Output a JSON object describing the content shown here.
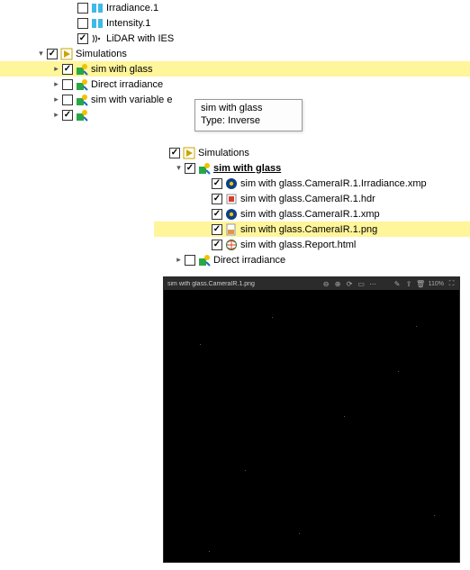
{
  "outer": {
    "items": [
      {
        "indent": 74,
        "exp": "",
        "chk": false,
        "icon": "sensor-icon",
        "label": "Irradiance.1"
      },
      {
        "indent": 74,
        "exp": "",
        "chk": false,
        "icon": "sensor-icon",
        "label": "Intensity.1"
      },
      {
        "indent": 74,
        "exp": "",
        "chk": true,
        "icon": "antenna-icon",
        "label": "LiDAR with IES"
      },
      {
        "indent": 40,
        "exp": "▾",
        "chk": true,
        "icon": "play-icon",
        "label": "Simulations"
      },
      {
        "indent": 57,
        "exp": "▸",
        "chk": true,
        "icon": "sim-icon",
        "label": "sim with glass",
        "sel": true
      },
      {
        "indent": 57,
        "exp": "▸",
        "chk": false,
        "icon": "sim-icon",
        "label": "Direct irradiance"
      },
      {
        "indent": 57,
        "exp": "▸",
        "chk": false,
        "icon": "sim-icon",
        "label": "sim with variable e"
      },
      {
        "indent": 57,
        "exp": "▸",
        "chk": true,
        "icon": "sim-icon",
        "label": ""
      }
    ]
  },
  "tooltip": {
    "line1": "sim with glass",
    "line2": "Type: Inverse"
  },
  "inner": {
    "items": [
      {
        "indent": 5,
        "exp": "",
        "chk": true,
        "icon": "play-icon",
        "label": "Simulations"
      },
      {
        "indent": 22,
        "exp": "▾",
        "chk": true,
        "icon": "sim-icon",
        "label": "sim with glass",
        "bold": true,
        "ul": true
      },
      {
        "indent": 52,
        "exp": "",
        "chk": true,
        "icon": "xmp-icon",
        "label": "sim with glass.CameraIR.1.Irradiance.xmp"
      },
      {
        "indent": 52,
        "exp": "",
        "chk": true,
        "icon": "hdr-icon",
        "label": "sim with glass.CameraIR.1.hdr"
      },
      {
        "indent": 52,
        "exp": "",
        "chk": true,
        "icon": "xmp-icon",
        "label": "sim with glass.CameraIR.1.xmp"
      },
      {
        "indent": 52,
        "exp": "",
        "chk": true,
        "icon": "png-icon",
        "label": "sim with glass.CameraIR.1.png",
        "sel": true
      },
      {
        "indent": 52,
        "exp": "",
        "chk": true,
        "icon": "html-icon",
        "label": "sim with glass.Report.html"
      },
      {
        "indent": 22,
        "exp": "▸",
        "chk": false,
        "icon": "sim-icon",
        "label": "Direct irradiance"
      }
    ]
  },
  "preview": {
    "title": "sim with glass.CameraIR.1.png",
    "zoom": "110%"
  }
}
